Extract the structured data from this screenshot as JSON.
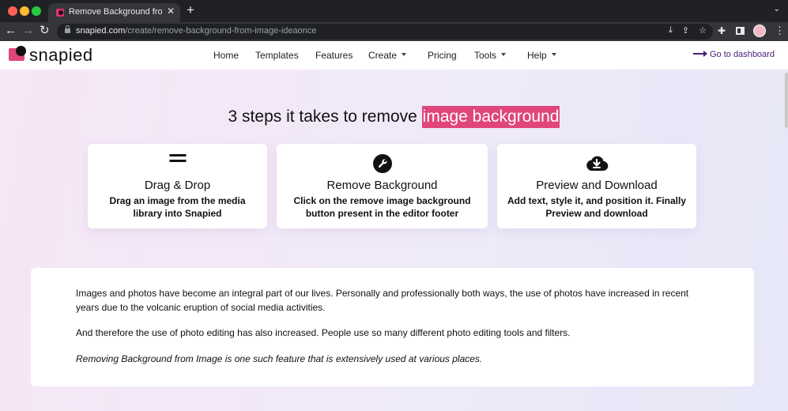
{
  "browser": {
    "tab_title": "Remove Background from Image",
    "tab_close": "✕",
    "new_tab": "+",
    "url_host": "snapied.com",
    "url_path": "/create/remove-background-from-image-ideaonce"
  },
  "header": {
    "logo_text": "snapied",
    "nav": [
      {
        "label": "Home"
      },
      {
        "label": "Templates"
      },
      {
        "label": "Features"
      },
      {
        "label": "Create"
      },
      {
        "label": "Pricing"
      },
      {
        "label": "Tools"
      },
      {
        "label": "Help"
      }
    ],
    "dashboard_link": "Go to dashboard"
  },
  "main": {
    "heading_prefix": "3 steps it takes to remove ",
    "heading_highlight": "image background",
    "steps": [
      {
        "icon": "equals-icon",
        "title": "Drag & Drop",
        "description": "Drag an image from the media library into Snapied"
      },
      {
        "icon": "wrench-icon",
        "title": "Remove Background",
        "description": "Click on the remove image background button present in the editor footer"
      },
      {
        "icon": "cloud-download-icon",
        "title": "Preview and Download",
        "description": "Add text, style it, and position it. Finally Preview and download"
      }
    ],
    "article": {
      "p1": "Images and photos have become an integral part of our lives. Personally and professionally both ways, the use of photos have increased in recent years due to the volcanic eruption of social media activities.",
      "p2": "And therefore the use of photo editing has also increased. People use so many different photo editing tools and filters.",
      "p3": "Removing Background from Image is one such feature that is extensively used at various places."
    }
  },
  "colors": {
    "accent": "#e0457b",
    "link": "#4a1d7a"
  }
}
